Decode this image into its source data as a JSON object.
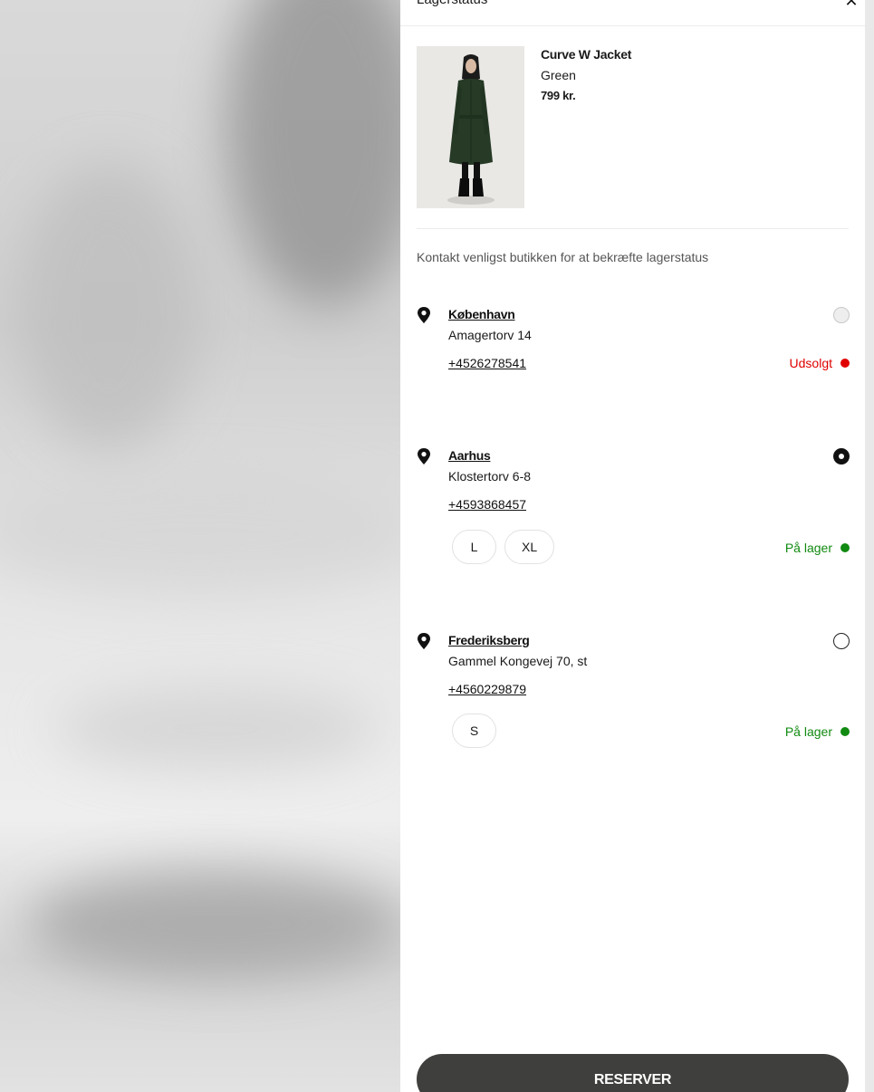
{
  "drawer": {
    "title": "Lagerstatus",
    "close_icon": "close-icon"
  },
  "product": {
    "name": "Curve W Jacket",
    "color": "Green",
    "price": "799 kr."
  },
  "notice": "Kontakt venligst butikken for at bekræfte lagerstatus",
  "stores": [
    {
      "name": "København",
      "address": "Amagertorv 14",
      "phone": "+4526278541",
      "selection": "disabled",
      "stock_label": "Udsolgt",
      "stock_color": "#e00000",
      "sizes": []
    },
    {
      "name": "Aarhus",
      "address": "Klostertorv 6-8",
      "phone": "+4593868457",
      "selection": "selected",
      "stock_label": "På lager",
      "stock_color": "#108a10",
      "sizes": [
        "L",
        "XL"
      ]
    },
    {
      "name": "Frederiksberg",
      "address": "Gammel Kongevej 70, st",
      "phone": "+4560229879",
      "selection": "unselected",
      "stock_label": "På lager",
      "stock_color": "#108a10",
      "sizes": [
        "S"
      ]
    }
  ],
  "reserve_button": "RESERVER",
  "colors": {
    "button_bg": "#3f3f3d",
    "out_of_stock": "#e00000",
    "in_stock": "#108a10"
  }
}
